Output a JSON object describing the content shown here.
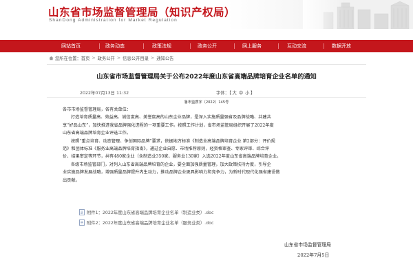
{
  "header": {
    "title": "山东省市场监督管理局（知识产权局）",
    "subtitle": "ShanDong  Administration  for  Market  Regulation"
  },
  "nav": {
    "items": [
      {
        "label": "网站首页"
      },
      {
        "label": "政务动态"
      },
      {
        "label": "政策法规"
      },
      {
        "label": "政务公开"
      },
      {
        "label": "网上服务"
      },
      {
        "label": "互动交流"
      },
      {
        "label": "数据开放"
      }
    ]
  },
  "breadcrumb": {
    "prefix": "您所在位置：",
    "items": [
      "首页",
      "政务公开",
      "信息公开目录",
      "通知公告"
    ]
  },
  "article": {
    "title": "山东省市场监督管理局关于公布2022年度山东省高端品牌培育企业名单的通知",
    "date": "2022年07月13日 11:32",
    "font_label": "字体：",
    "font_open": "【",
    "font_large": "大",
    "font_medium": "中",
    "font_small": "小",
    "font_close": "】",
    "doc_number": "鲁市监质字〔2022〕145号",
    "paragraphs": [
      "各市市场监督管理局，各有关单位：",
      "打造培育质量高、效益高、诚信度高、美誉度高的山东企业品牌，是深入实施质量强省及品牌战略、共建共",
      "享“好品山东”，加快推进我省品牌强化进程的一项重要工作。按照工作计划，省市场监管局组织开展了2022年度",
      "山东省高端品牌培育企业评选工作。",
      "按照“重点培育、动态管理、争创国际品牌”要求，依据地方标准《制造业高端品牌培育企业 第2部分：评价规",
      "范》和团体标准《服务业高端品牌培育指南》，通过企业自愿、市场推荐原则，经资格审查、专家评审、综合评",
      "价、结果审定等环节，共有480家企业（含制造业350家、服务业130家）入选2022年度山东省高端品牌培育企业。",
      "各级市场监管部门，对列入山东省高端品牌培育的企业，要全面加强质量管理，加大政策扶持力度，引导企",
      "业实施品牌发展战略，增强质量品牌提升内生动力，推动品牌企业更具影响力和竞争力，为新时代现代化强省建设做",
      "出贡献。"
    ],
    "attachments": [
      {
        "label": "附件1：2022年度山东省高端品牌培育企业名单（制造业类）.doc"
      },
      {
        "label": "附件2：2022年度山东省高端品牌培育企业名单（服务业类）.doc"
      }
    ],
    "signature": "山东省市场监督管理局",
    "sign_date": "2022年7月5日"
  },
  "colors": {
    "brand_red": "#c4161c",
    "text": "#333333"
  }
}
